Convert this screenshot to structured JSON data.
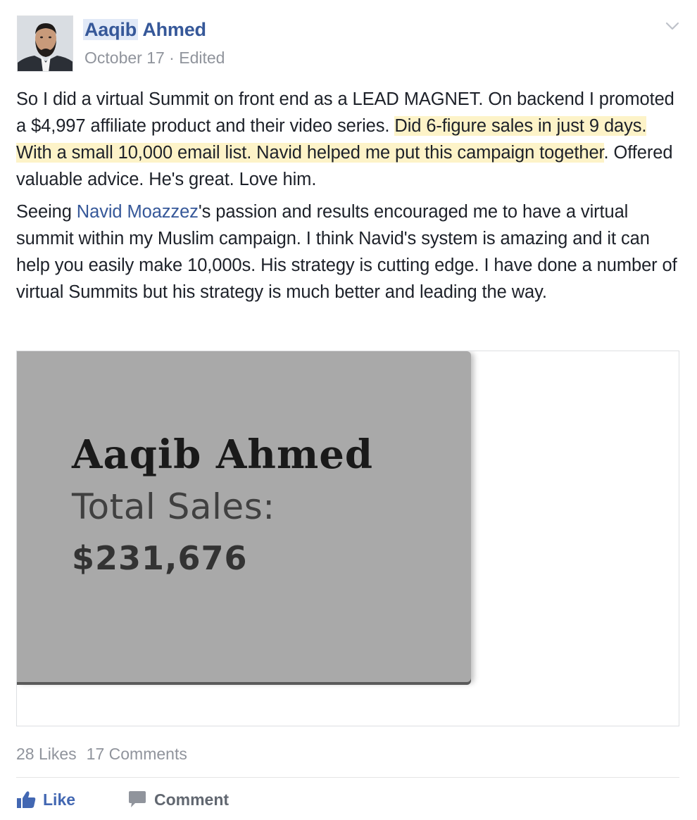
{
  "post": {
    "author": {
      "first_name": "Aaqib",
      "last_name": "Ahmed"
    },
    "meta": {
      "date": "October 17",
      "separator": " · ",
      "edited": "Edited"
    },
    "paragraph1": {
      "part1": "So I did a virtual Summit on front end as a LEAD MAGNET. On backend I promoted a $4,997 affiliate product and their video series. ",
      "highlight": "Did 6-figure sales in just 9 days. With a small 10,000 email list. Navid helped me put this campaign together",
      "part2": ". Offered valuable advice. He's great. Love him."
    },
    "paragraph2": {
      "part1": "Seeing ",
      "mention": "Navid Moazzez",
      "part2": "'s passion and results encouraged me to have a virtual summit within my Muslim campaign. I think Navid's system is amazing and it can help you easily make 10,000s. His strategy is cutting edge. I have done a number of virtual Summits but his strategy is much better and leading the way."
    },
    "image": {
      "name": "Aaqib Ahmed",
      "label": "Total Sales:",
      "value": "$231,676"
    },
    "stats": {
      "likes": "28 Likes",
      "comments": "17 Comments"
    },
    "actions": {
      "like": "Like",
      "comment": "Comment"
    },
    "colors": {
      "link": "#365899",
      "highlight": "#fdf3c8",
      "like_blue": "#4267b2",
      "muted": "#90949c"
    },
    "icons": {
      "menu": "chevron-down-icon",
      "like": "thumbs-up-icon",
      "comment": "speech-bubble-icon"
    }
  }
}
